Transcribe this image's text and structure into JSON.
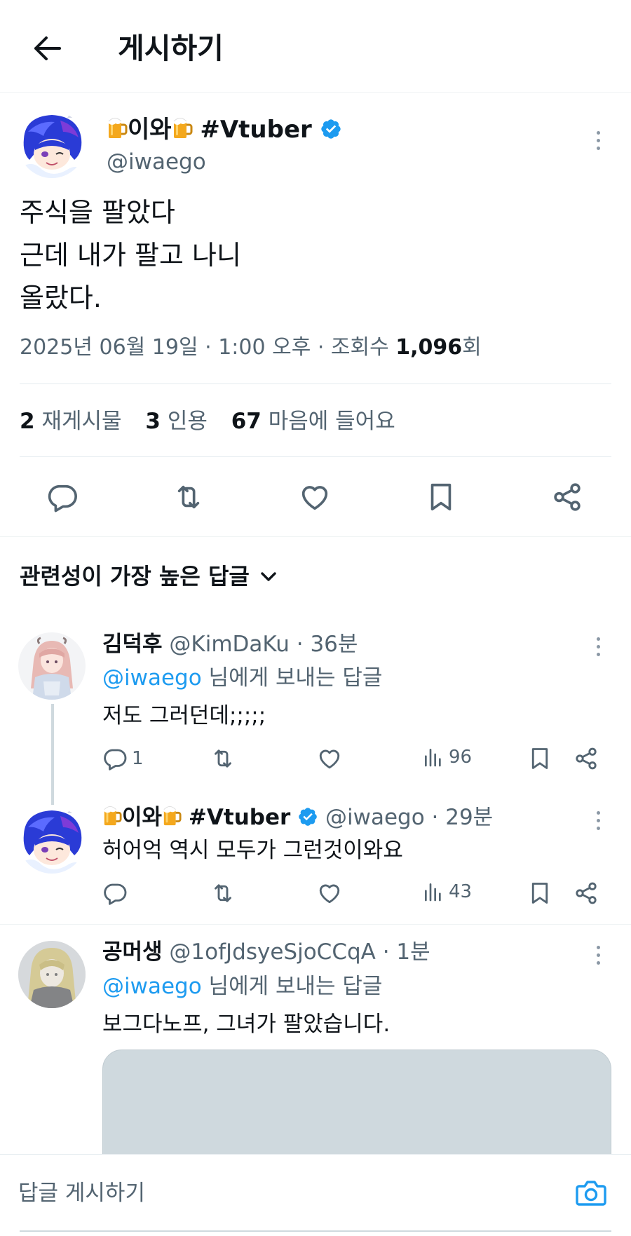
{
  "header": {
    "title": "게시하기"
  },
  "post": {
    "display_name_mid": "이와",
    "display_name_tag": "#Vtuber",
    "handle": "@iwaego",
    "body_lines": [
      "주식을 팔았다",
      "근데 내가 팔고 나니",
      "올랐다."
    ],
    "meta": {
      "date": "2025년 06월 19일",
      "time": "1:00 오후",
      "views_label": "조회수",
      "views_count": "1,096",
      "views_suffix": "회"
    },
    "stats": {
      "reposts_count": "2",
      "reposts_label": "재게시물",
      "quotes_count": "3",
      "quotes_label": "인용",
      "likes_count": "67",
      "likes_label": "마음에 들어요"
    }
  },
  "replies_sort": {
    "label": "관련성이 가장 높은 답글"
  },
  "replies": [
    {
      "name": "김덕후",
      "handle": "@KimDaKu",
      "time": "36분",
      "replying_to_handle": "@iwaego",
      "replying_to_suffix": "님에게 보내는 답글",
      "text": "저도 그러던데;;;;;",
      "reply_count": "1",
      "views": "96"
    },
    {
      "name_mid": "이와",
      "name_tag": "#Vtuber",
      "handle": "@iwaego",
      "time": "29분",
      "text": "허어억 역시 모두가 그런것이와요",
      "views": "43"
    },
    {
      "name": "공머생",
      "handle": "@1ofJdsyeSjoCCqA",
      "time": "1분",
      "replying_to_handle": "@iwaego",
      "replying_to_suffix": "님에게 보내는 답글",
      "text": "보그다노프, 그녀가 팔았습니다."
    }
  ],
  "composer": {
    "placeholder": "답글 게시하기"
  },
  "colors": {
    "accent": "#1d9bf0",
    "text": "#0f1419",
    "muted": "#536471",
    "verified": "#1d9bf0"
  },
  "icons": [
    "back-arrow-icon",
    "beer-mug-icon",
    "verified-badge-icon",
    "more-dots-icon",
    "reply-icon",
    "repost-icon",
    "like-icon",
    "bookmark-icon",
    "share-icon",
    "views-icon",
    "chevron-down-icon",
    "camera-icon"
  ]
}
